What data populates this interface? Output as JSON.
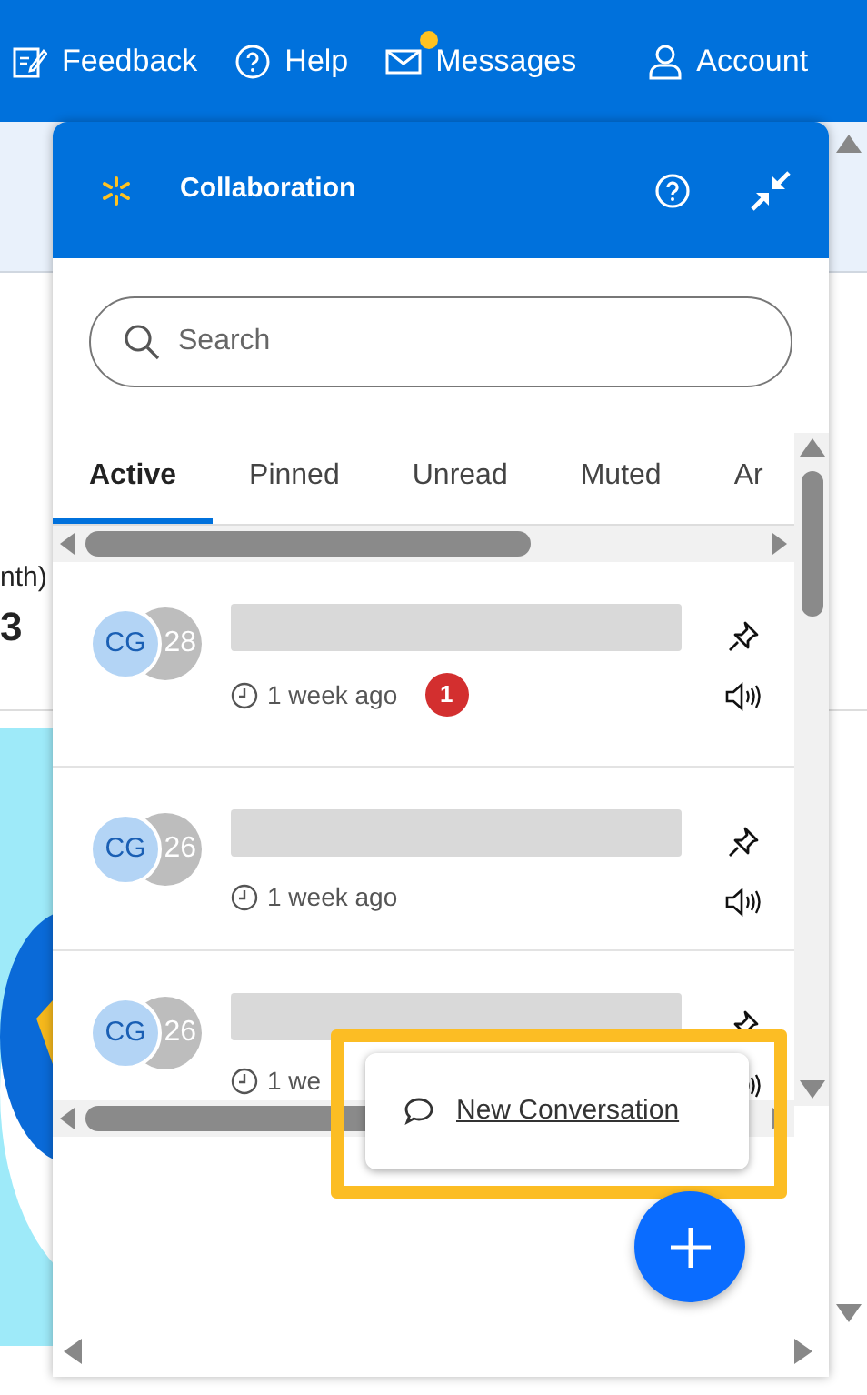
{
  "top_nav": [
    {
      "kind": "feedback",
      "label": "Feedback",
      "notify": false
    },
    {
      "kind": "help",
      "label": "Help",
      "notify": false
    },
    {
      "kind": "mail",
      "label": "Messages",
      "notify": true
    },
    {
      "kind": "account",
      "label": "Account",
      "notify": false
    }
  ],
  "background": {
    "caption": "nth)",
    "value": "3"
  },
  "panel": {
    "title": "Collaboration",
    "search": {
      "placeholder": "Search"
    },
    "tabs": [
      {
        "label": "Active",
        "selected": true
      },
      {
        "label": "Pinned",
        "selected": false
      },
      {
        "label": "Unread",
        "selected": false
      },
      {
        "label": "Muted",
        "selected": false
      },
      {
        "label": "Ar",
        "selected": false
      }
    ],
    "conversations": [
      {
        "initials": "CG",
        "count": "28",
        "time": "1 week ago",
        "unread": "1"
      },
      {
        "initials": "CG",
        "count": "26",
        "time": "1 week ago"
      },
      {
        "initials": "CG",
        "count": "26",
        "time": "1 we"
      }
    ],
    "popup": {
      "label": "New Conversation"
    }
  }
}
